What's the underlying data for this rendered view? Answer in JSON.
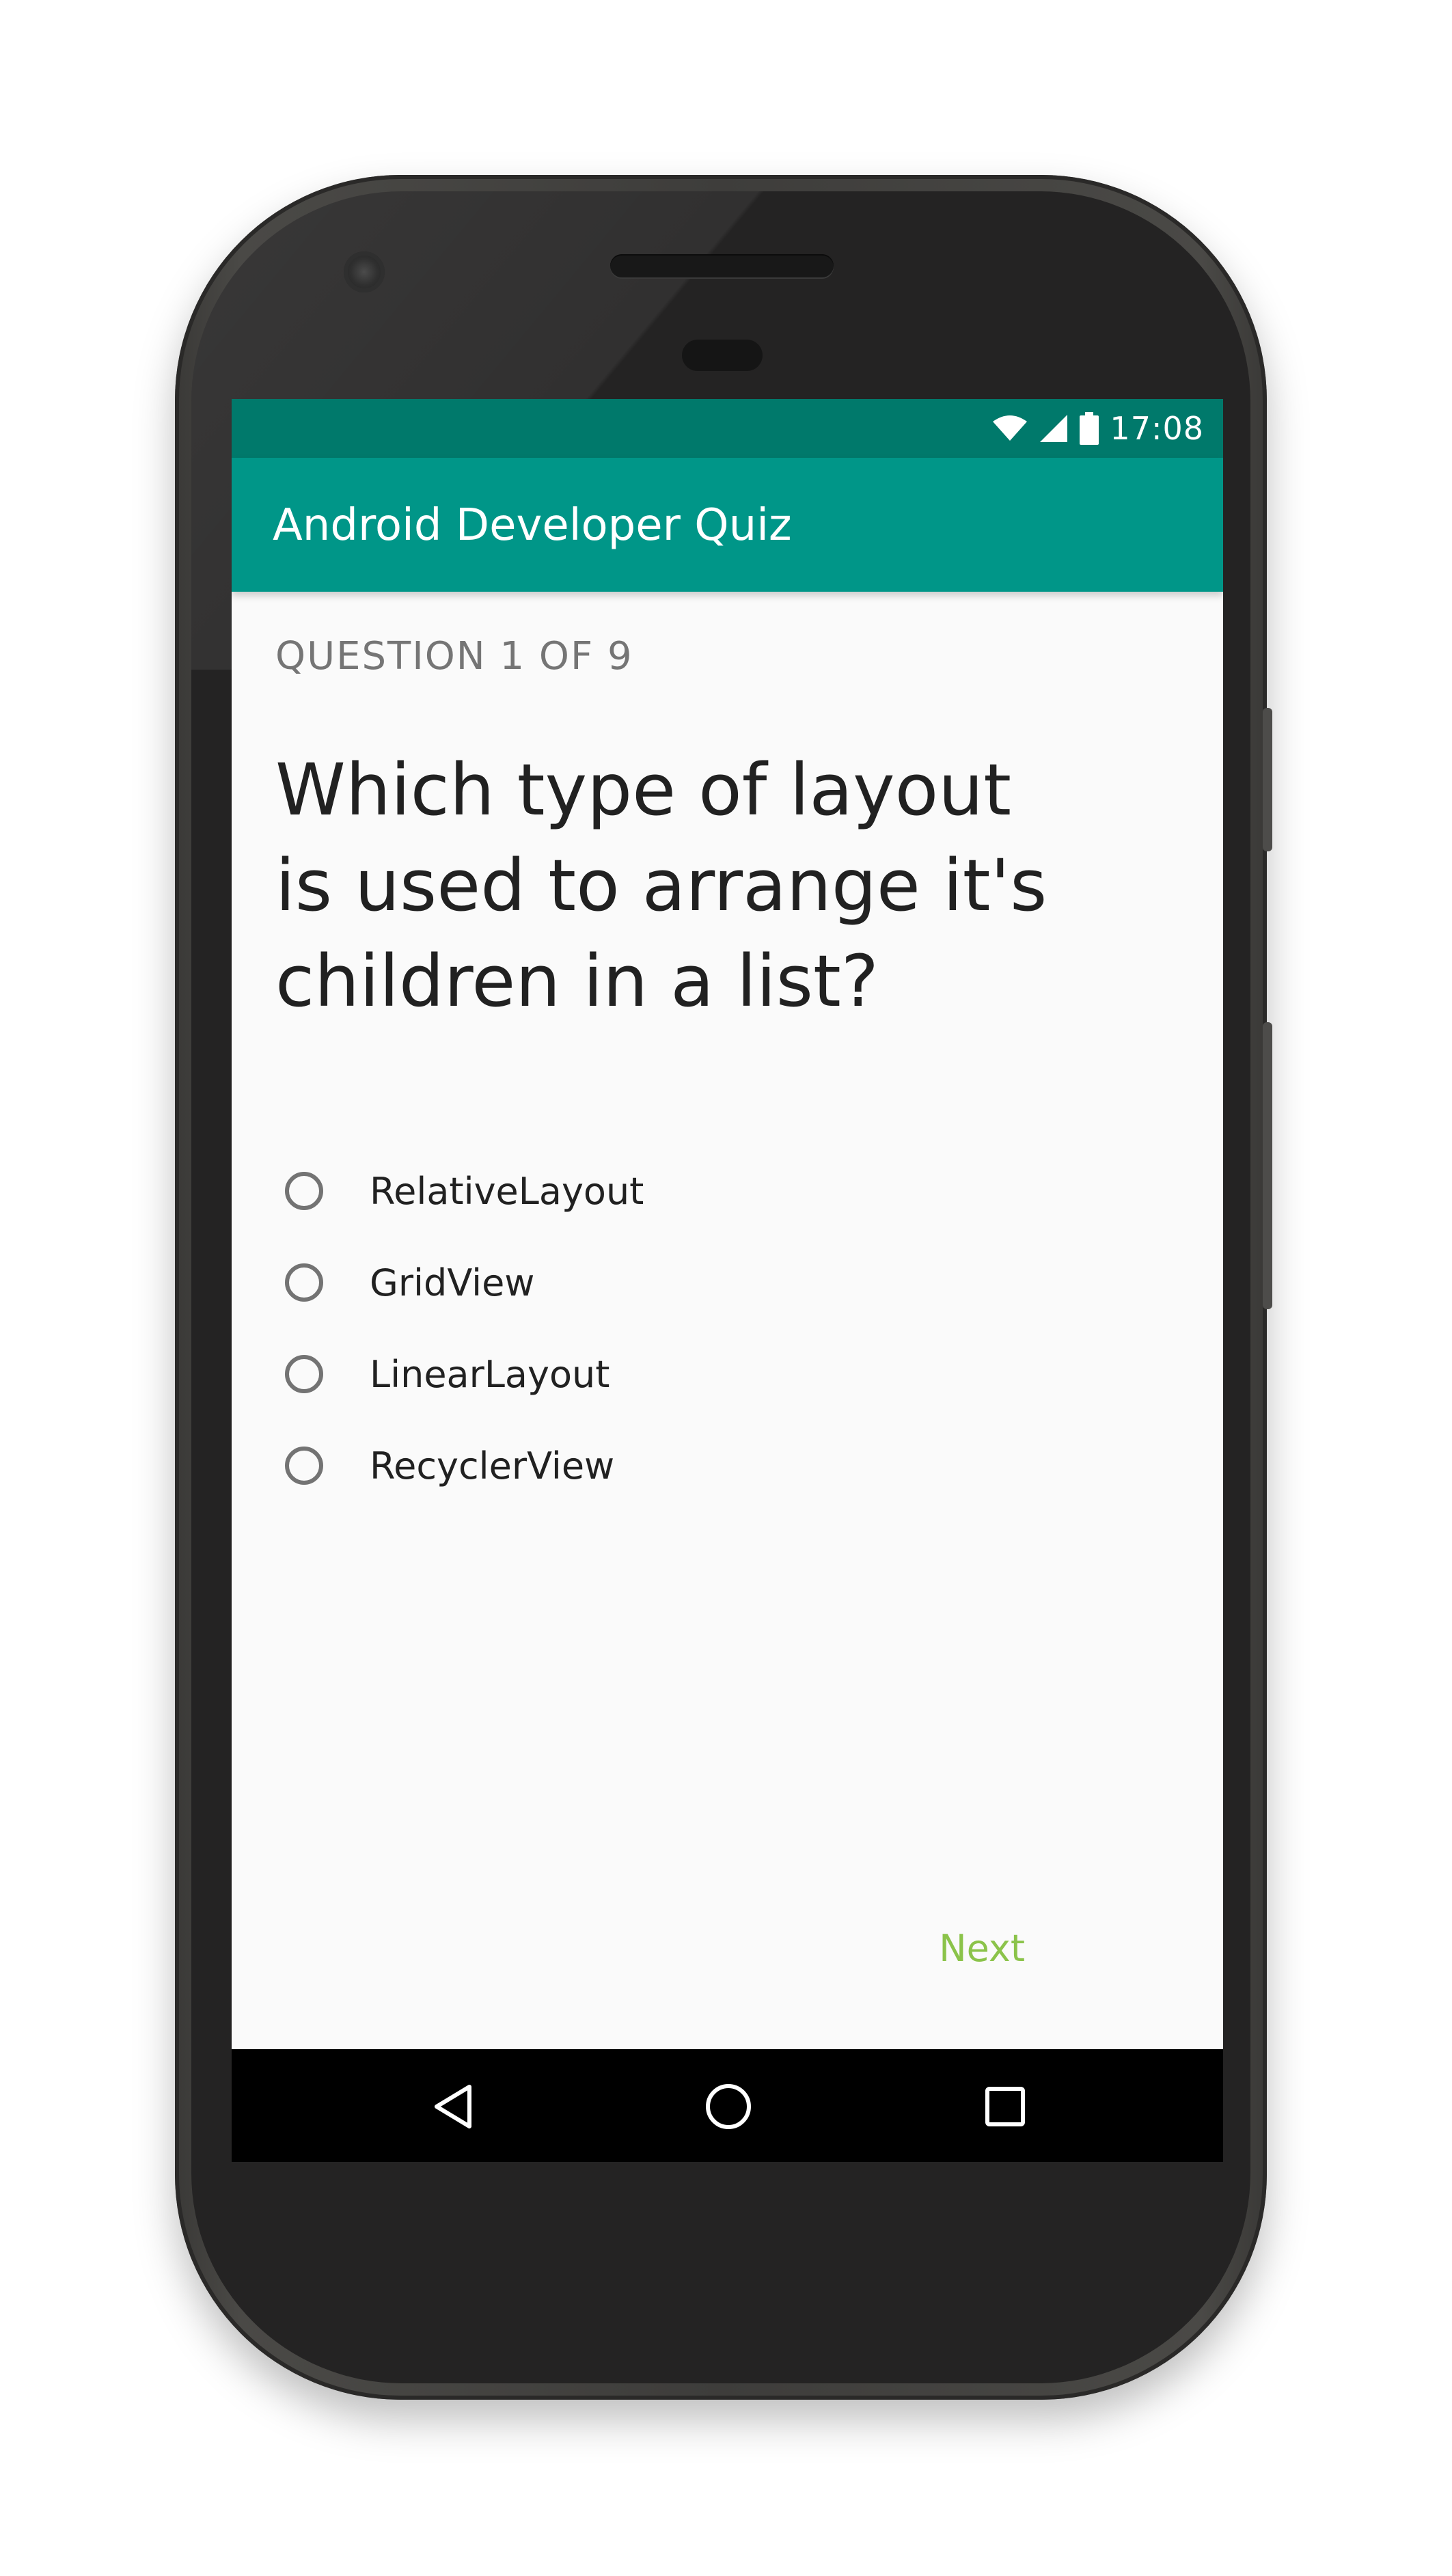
{
  "status_bar": {
    "time": "17:08",
    "icons": [
      "wifi-icon",
      "cell-signal-icon",
      "battery-icon"
    ],
    "background": "#00796b"
  },
  "app_bar": {
    "title": "Android Developer Quiz",
    "background": "#009688"
  },
  "quiz": {
    "counter": "QUESTION 1 OF 9",
    "question_line1": "Which type of layout",
    "question_line2": "is used to arrange it's",
    "question_line3": "children in a list?",
    "options": [
      {
        "label": "RelativeLayout",
        "selected": false
      },
      {
        "label": "GridView",
        "selected": false
      },
      {
        "label": "LinearLayout",
        "selected": false
      },
      {
        "label": "RecyclerView",
        "selected": false
      }
    ],
    "next_label": "Next",
    "accent": "#8bc34a"
  },
  "nav_bar": {
    "buttons": [
      "back-icon",
      "home-icon",
      "recents-icon"
    ]
  }
}
